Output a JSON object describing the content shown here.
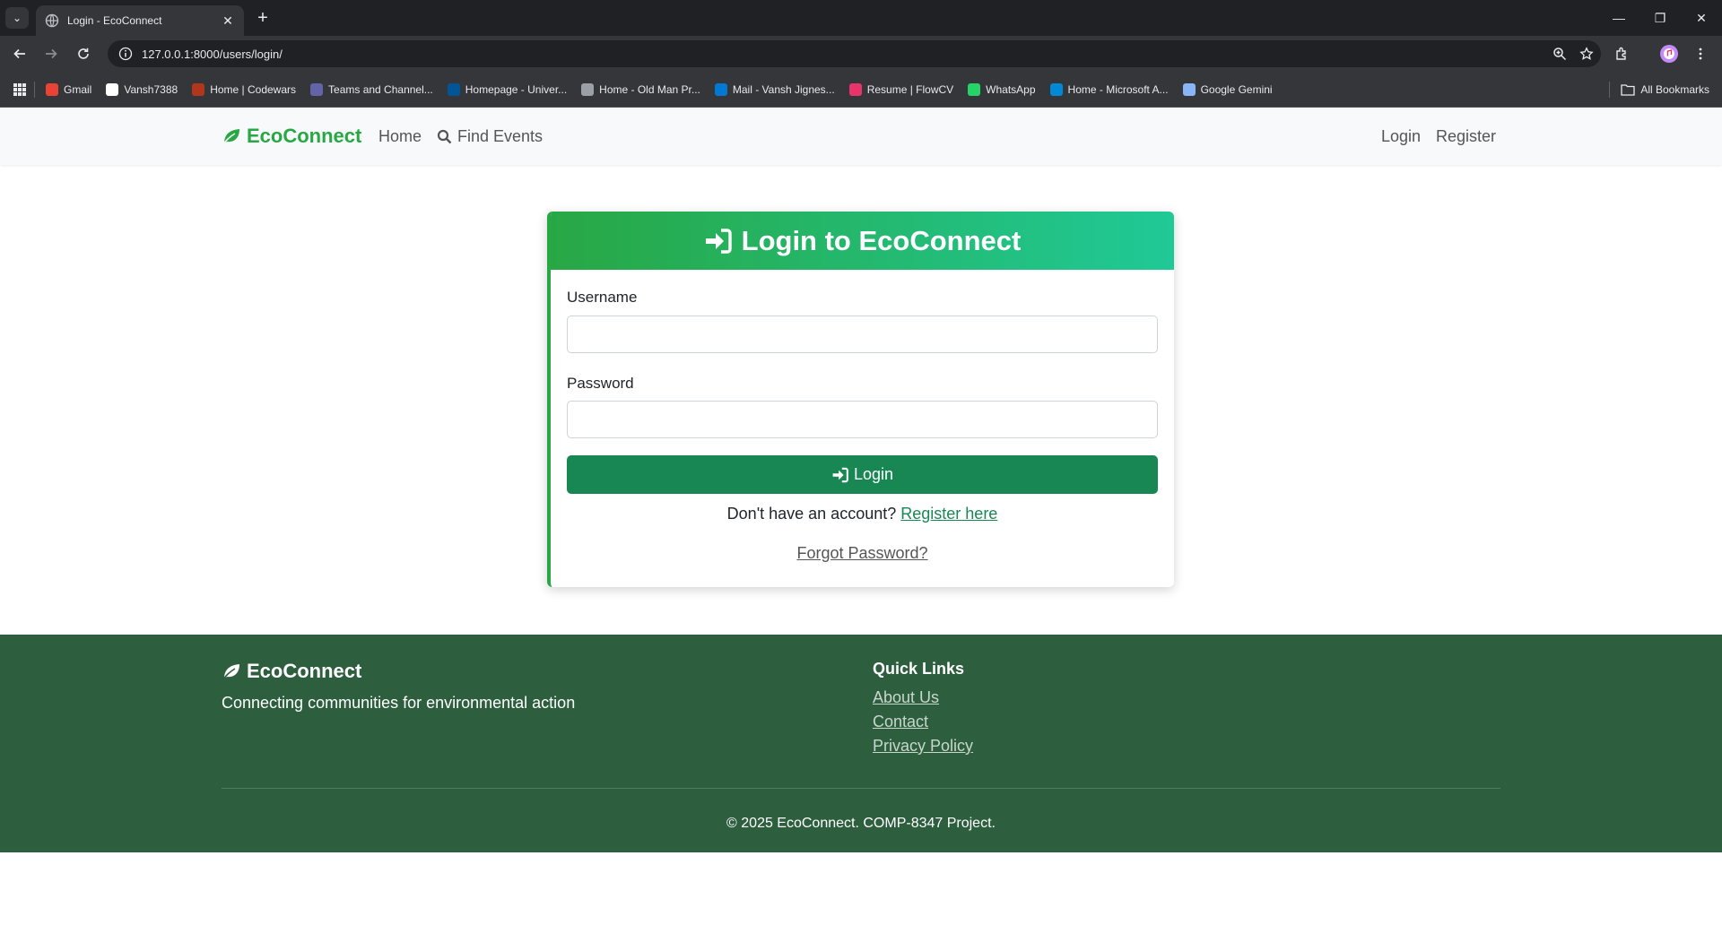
{
  "browser": {
    "tab_title": "Login - EcoConnect",
    "url": "127.0.0.1:8000/users/login/",
    "bookmarks": [
      {
        "label": "Gmail",
        "icon": "gmail-icon",
        "color": "#ea4335"
      },
      {
        "label": "Vansh7388",
        "icon": "github-icon",
        "color": "#ffffff"
      },
      {
        "label": "Home | Codewars",
        "icon": "codewars-icon",
        "color": "#b1361e"
      },
      {
        "label": "Teams and Channel...",
        "icon": "teams-icon",
        "color": "#6264a7"
      },
      {
        "label": "Homepage - Univer...",
        "icon": "windsor-icon",
        "color": "#005596"
      },
      {
        "label": "Home - Old Man Pr...",
        "icon": "globe-icon",
        "color": "#9aa0a6"
      },
      {
        "label": "Mail - Vansh Jignes...",
        "icon": "outlook-icon",
        "color": "#0078d4"
      },
      {
        "label": "Resume | FlowCV",
        "icon": "flowcv-icon",
        "color": "#e8336b"
      },
      {
        "label": "WhatsApp",
        "icon": "whatsapp-icon",
        "color": "#25d366"
      },
      {
        "label": "Home - Microsoft A...",
        "icon": "azure-icon",
        "color": "#0089d6"
      },
      {
        "label": "Google Gemini",
        "icon": "gemini-icon",
        "color": "#8ab4f8"
      }
    ],
    "all_bookmarks": "All Bookmarks"
  },
  "navbar": {
    "brand": "EcoConnect",
    "home": "Home",
    "find_events": "Find Events",
    "login": "Login",
    "register": "Register"
  },
  "login_card": {
    "title": "Login to EcoConnect",
    "username_label": "Username",
    "username_value": "",
    "password_label": "Password",
    "password_value": "",
    "submit_label": "Login",
    "no_account_text": "Don't have an account?",
    "register_link": "Register here",
    "forgot_link": "Forgot Password?"
  },
  "footer": {
    "brand": "EcoConnect",
    "tagline": "Connecting communities for environmental action",
    "quick_links_title": "Quick Links",
    "links": [
      "About Us",
      "Contact",
      "Privacy Policy"
    ],
    "copyright": "© 2025 EcoConnect. COMP-8347 Project."
  },
  "colors": {
    "brand_green": "#28a745",
    "button_green": "#198754",
    "footer_green": "#2d5f3f",
    "header_gradient_end": "#20c997"
  }
}
